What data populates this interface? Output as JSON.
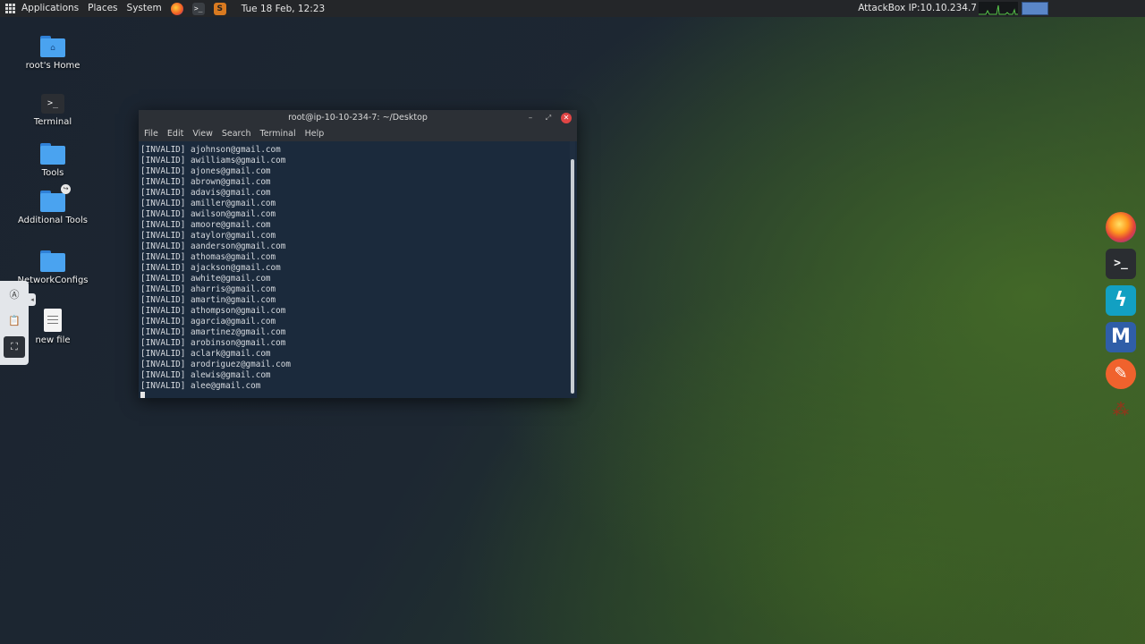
{
  "top_panel": {
    "menus": [
      "Applications",
      "Places",
      "System"
    ],
    "clock": "Tue 18 Feb, 12:23",
    "attackbox_ip": "AttackBox IP:10.10.234.7"
  },
  "desktop_icons": [
    {
      "label": "root's Home",
      "icon": "home-folder-icon"
    },
    {
      "label": "Terminal",
      "icon": "terminal-icon"
    },
    {
      "label": "Tools",
      "icon": "folder-icon"
    },
    {
      "label": "Additional Tools",
      "icon": "folder-link-icon"
    },
    {
      "label": "NetworkConfigs",
      "icon": "folder-icon"
    },
    {
      "label": "new file",
      "icon": "text-file-icon"
    }
  ],
  "terminal": {
    "title": "root@ip-10-10-234-7: ~/Desktop",
    "menu": [
      "File",
      "Edit",
      "View",
      "Search",
      "Terminal",
      "Help"
    ],
    "lines": [
      "[INVALID] ajohnson@gmail.com",
      "[INVALID] awilliams@gmail.com",
      "[INVALID] ajones@gmail.com",
      "[INVALID] abrown@gmail.com",
      "[INVALID] adavis@gmail.com",
      "[INVALID] amiller@gmail.com",
      "[INVALID] awilson@gmail.com",
      "[INVALID] amoore@gmail.com",
      "[INVALID] ataylor@gmail.com",
      "[INVALID] aanderson@gmail.com",
      "[INVALID] athomas@gmail.com",
      "[INVALID] ajackson@gmail.com",
      "[INVALID] awhite@gmail.com",
      "[INVALID] aharris@gmail.com",
      "[INVALID] amartin@gmail.com",
      "[INVALID] athompson@gmail.com",
      "[INVALID] agarcia@gmail.com",
      "[INVALID] amartinez@gmail.com",
      "[INVALID] arobinson@gmail.com",
      "[INVALID] aclark@gmail.com",
      "[INVALID] arodriguez@gmail.com",
      "[INVALID] alewis@gmail.com",
      "[INVALID] alee@gmail.com"
    ]
  },
  "left_toolbar": {
    "tools": [
      "accessibility-icon",
      "clipboard-icon",
      "screen-resize-icon"
    ]
  },
  "dock": {
    "apps": [
      "firefox-icon",
      "terminal-icon",
      "zap-icon",
      "metasploit-icon",
      "burpsuite-icon",
      "misc-tool-icon"
    ]
  },
  "colors": {
    "panel": "#242629",
    "terminal_bg": "#1b2a3c",
    "close_button": "#e14545",
    "folder": "#4aa3f0"
  }
}
